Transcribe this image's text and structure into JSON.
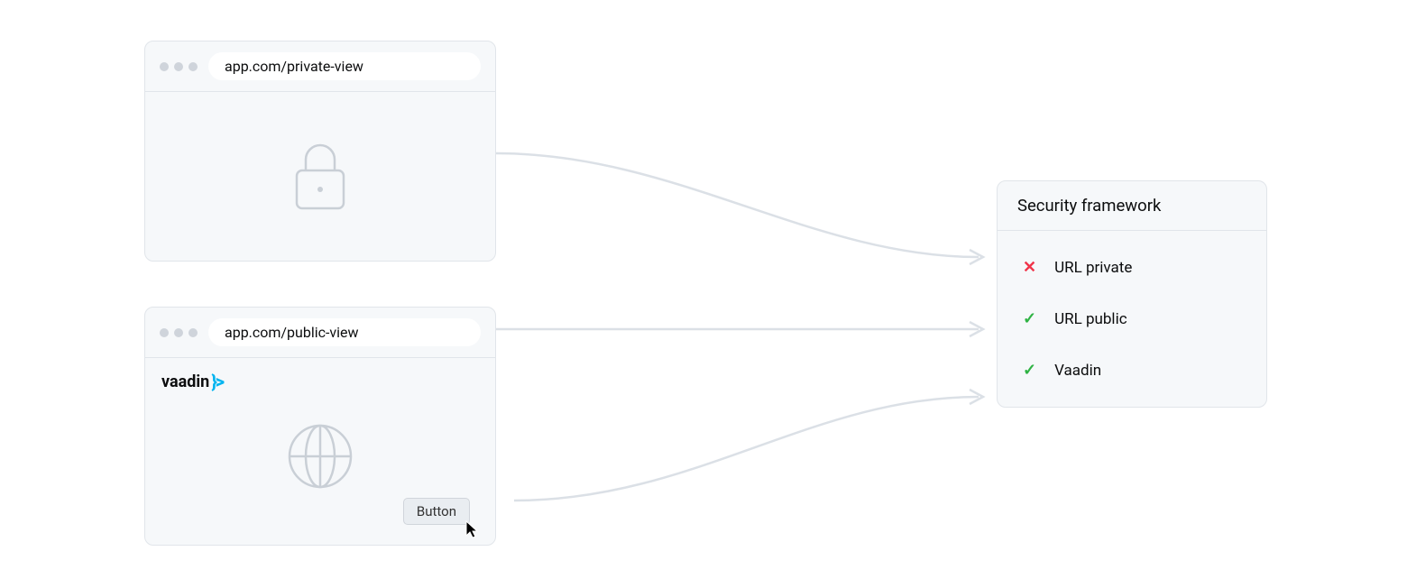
{
  "browsers": {
    "private": {
      "url": "app.com/private-view"
    },
    "public": {
      "url": "app.com/public-view",
      "logo_text": "vaadin",
      "button_label": "Button"
    }
  },
  "security_panel": {
    "title": "Security framework",
    "items": [
      {
        "status": "deny",
        "label": "URL private"
      },
      {
        "status": "allow",
        "label": "URL public"
      },
      {
        "status": "allow",
        "label": "Vaadin"
      }
    ]
  }
}
